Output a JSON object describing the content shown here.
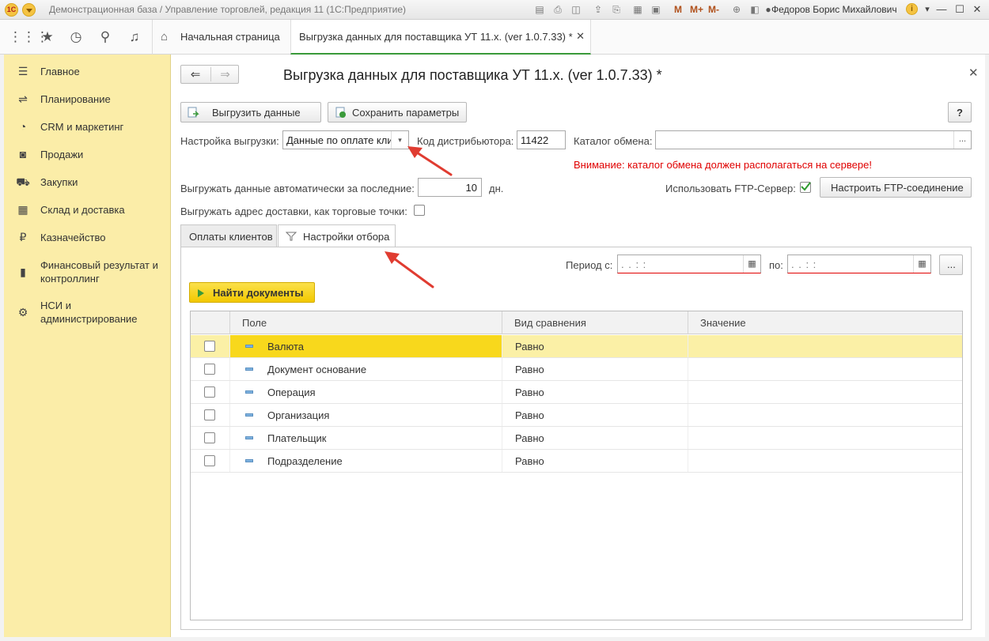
{
  "app": {
    "title": "Демонстрационная база / Управление торговлей, редакция 11  (1С:Предприятие)",
    "logo_text": "1С",
    "user": "Федоров Борис Михайлович",
    "toolbar_m_buttons": [
      "M",
      "M+",
      "M-"
    ],
    "info_icon": "i"
  },
  "tabs": {
    "home_label": "Начальная страница",
    "active_label": "Выгрузка данных для поставщика УТ 11.х. (ver 1.0.7.33) *"
  },
  "sidebar": {
    "items": [
      {
        "label": "Главное",
        "icon": "menu-icon"
      },
      {
        "label": "Планирование",
        "icon": "planning-icon"
      },
      {
        "label": "CRM и маркетинг",
        "icon": "crm-icon"
      },
      {
        "label": "Продажи",
        "icon": "bag-icon"
      },
      {
        "label": "Закупки",
        "icon": "cart-icon"
      },
      {
        "label": "Склад и доставка",
        "icon": "warehouse-icon"
      },
      {
        "label": "Казначейство",
        "icon": "ruble-icon"
      },
      {
        "label": "Финансовый результат и контроллинг",
        "icon": "chart-icon"
      },
      {
        "label": "НСИ и администрирование",
        "icon": "gear-icon"
      }
    ]
  },
  "form": {
    "title": "Выгрузка данных для поставщика УТ 11.х. (ver 1.0.7.33) *",
    "export_button": "Выгрузить данные",
    "save_params_button": "Сохранить параметры",
    "help_button": "?",
    "export_setting_label": "Настройка выгрузки:",
    "export_setting_value": "Данные по оплате кли",
    "distributor_code_label": "Код дистрибьютора:",
    "distributor_code_value": "11422",
    "exchange_catalog_label": "Каталог обмена:",
    "exchange_catalog_value": "",
    "warning": "Внимание: каталог обмена должен располагаться на сервере!",
    "auto_export_label": "Выгружать данные автоматически за последние:",
    "auto_export_days": "10",
    "days_unit": "дн.",
    "use_ftp_label": "Использовать FTP-Сервер:",
    "use_ftp_checked": true,
    "configure_ftp_button": "Настроить FTP-соединение",
    "export_address_label": "Выгружать адрес доставки, как торговые точки:",
    "export_address_checked": false,
    "ellipsis": "..."
  },
  "inner_tabs": [
    {
      "label": "Оплаты клиентов",
      "active": false
    },
    {
      "label": "Настройки отбора",
      "active": true
    }
  ],
  "filter_panel": {
    "period_from_label": "Период с:",
    "period_from_value": "  .  .        :  :  ",
    "period_to_label": "по:",
    "period_to_value": "  .  .        :  :  ",
    "find_button": "Найти документы",
    "columns": [
      "Поле",
      "Вид сравнения",
      "Значение"
    ],
    "rows": [
      {
        "field": "Валюта",
        "comparison": "Равно",
        "value": "",
        "checked": false,
        "selected": true
      },
      {
        "field": "Документ основание",
        "comparison": "Равно",
        "value": "",
        "checked": false,
        "selected": false
      },
      {
        "field": "Операция",
        "comparison": "Равно",
        "value": "",
        "checked": false,
        "selected": false
      },
      {
        "field": "Организация",
        "comparison": "Равно",
        "value": "",
        "checked": false,
        "selected": false
      },
      {
        "field": "Плательщик",
        "comparison": "Равно",
        "value": "",
        "checked": false,
        "selected": false
      },
      {
        "field": "Подразделение",
        "comparison": "Равно",
        "value": "",
        "checked": false,
        "selected": false
      }
    ]
  },
  "colors": {
    "sidebar_bg": "#fbeda8",
    "selected_row": "#fbf0a6",
    "selected_cell": "#f8d81c",
    "find_button": "#f2c800",
    "warning": "#e00000",
    "active_tab_underline": "#3a9a3a",
    "annotation_arrow": "#e03c31"
  }
}
